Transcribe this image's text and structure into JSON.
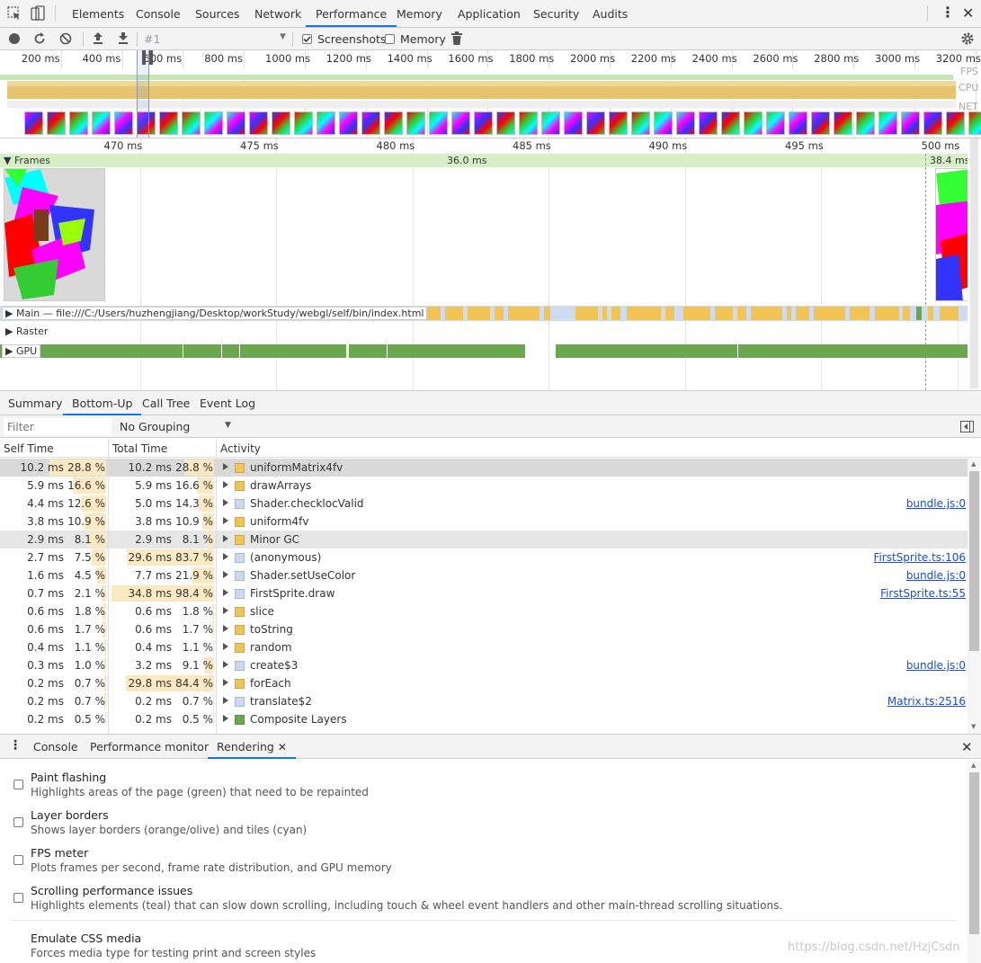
{
  "main_tabs": [
    "Elements",
    "Console",
    "Sources",
    "Network",
    "Performance",
    "Memory",
    "Application",
    "Security",
    "Audits"
  ],
  "toolbar": {
    "recording": "#1",
    "screenshots_label": "Screenshots",
    "memory_label": "Memory"
  },
  "overview": {
    "ticks": [
      "200 ms",
      "400 ms",
      "600 ms",
      "800 ms",
      "1000 ms",
      "1200 ms",
      "1400 ms",
      "1600 ms",
      "1800 ms",
      "2000 ms",
      "2200 ms",
      "2400 ms",
      "2600 ms",
      "2800 ms",
      "3000 ms",
      "3200 ms"
    ],
    "lanes": [
      "FPS",
      "CPU",
      "NET"
    ]
  },
  "ruler": {
    "ticks": [
      "470 ms",
      "475 ms",
      "480 ms",
      "485 ms",
      "490 ms",
      "495 ms",
      "500 ms"
    ]
  },
  "frames": {
    "label": "Frames",
    "duration": "36.0 ms",
    "next_duration": "38.4 ms"
  },
  "tracks": {
    "main": "Main — file:///C:/Users/huzhengjiang/Desktop/workStudy/webgl/self/bin/index.html",
    "raster": "Raster",
    "gpu": "GPU"
  },
  "bottom_tabs": [
    "Summary",
    "Bottom-Up",
    "Call Tree",
    "Event Log"
  ],
  "filter": {
    "placeholder": "Filter",
    "grouping": "No Grouping"
  },
  "columns": {
    "self": "Self Time",
    "total": "Total Time",
    "activity": "Activity"
  },
  "colors": {
    "scripting": "#f1c453",
    "system": "#c9d9f0",
    "rendering": "#6aa84f",
    "accent": "#1a73e8",
    "link": "#1a4ed8"
  },
  "rows": [
    {
      "self_ms": "10.2 ms",
      "self_pct": "28.8 %",
      "self_frac": 0.288,
      "total_ms": "10.2 ms",
      "total_pct": "28.8 %",
      "total_frac": 0.288,
      "activity": "uniformMatrix4fv",
      "cat": "scripting",
      "source": ""
    },
    {
      "self_ms": "5.9 ms",
      "self_pct": "16.6 %",
      "self_frac": 0.166,
      "total_ms": "5.9 ms",
      "total_pct": "16.6 %",
      "total_frac": 0.166,
      "activity": "drawArrays",
      "cat": "scripting",
      "source": ""
    },
    {
      "self_ms": "4.4 ms",
      "self_pct": "12.6 %",
      "self_frac": 0.126,
      "total_ms": "5.0 ms",
      "total_pct": "14.3 %",
      "total_frac": 0.143,
      "activity": "Shader.checklocValid",
      "cat": "system",
      "source": "bundle.js:0"
    },
    {
      "self_ms": "3.8 ms",
      "self_pct": "10.9 %",
      "self_frac": 0.109,
      "total_ms": "3.8 ms",
      "total_pct": "10.9 %",
      "total_frac": 0.109,
      "activity": "uniform4fv",
      "cat": "scripting",
      "source": ""
    },
    {
      "self_ms": "2.9 ms",
      "self_pct": "8.1 %",
      "self_frac": 0.081,
      "total_ms": "2.9 ms",
      "total_pct": "8.1 %",
      "total_frac": 0.081,
      "activity": "Minor GC",
      "cat": "scripting",
      "source": ""
    },
    {
      "self_ms": "2.7 ms",
      "self_pct": "7.5 %",
      "self_frac": 0.075,
      "total_ms": "29.6 ms",
      "total_pct": "83.7 %",
      "total_frac": 0.837,
      "activity": "(anonymous)",
      "cat": "system",
      "source": "FirstSprite.ts:106"
    },
    {
      "self_ms": "1.6 ms",
      "self_pct": "4.5 %",
      "self_frac": 0.045,
      "total_ms": "7.7 ms",
      "total_pct": "21.9 %",
      "total_frac": 0.219,
      "activity": "Shader.setUseColor",
      "cat": "system",
      "source": "bundle.js:0"
    },
    {
      "self_ms": "0.7 ms",
      "self_pct": "2.1 %",
      "self_frac": 0.021,
      "total_ms": "34.8 ms",
      "total_pct": "98.4 %",
      "total_frac": 0.984,
      "activity": "FirstSprite.draw",
      "cat": "system",
      "source": "FirstSprite.ts:55"
    },
    {
      "self_ms": "0.6 ms",
      "self_pct": "1.8 %",
      "self_frac": 0.018,
      "total_ms": "0.6 ms",
      "total_pct": "1.8 %",
      "total_frac": 0.018,
      "activity": "slice",
      "cat": "scripting",
      "source": ""
    },
    {
      "self_ms": "0.6 ms",
      "self_pct": "1.7 %",
      "self_frac": 0.017,
      "total_ms": "0.6 ms",
      "total_pct": "1.7 %",
      "total_frac": 0.017,
      "activity": "toString",
      "cat": "scripting",
      "source": ""
    },
    {
      "self_ms": "0.4 ms",
      "self_pct": "1.1 %",
      "self_frac": 0.011,
      "total_ms": "0.4 ms",
      "total_pct": "1.1 %",
      "total_frac": 0.011,
      "activity": "random",
      "cat": "scripting",
      "source": ""
    },
    {
      "self_ms": "0.3 ms",
      "self_pct": "1.0 %",
      "self_frac": 0.01,
      "total_ms": "3.2 ms",
      "total_pct": "9.1 %",
      "total_frac": 0.091,
      "activity": "create$3",
      "cat": "system",
      "source": "bundle.js:0"
    },
    {
      "self_ms": "0.2 ms",
      "self_pct": "0.7 %",
      "self_frac": 0.007,
      "total_ms": "29.8 ms",
      "total_pct": "84.4 %",
      "total_frac": 0.844,
      "activity": "forEach",
      "cat": "scripting",
      "source": ""
    },
    {
      "self_ms": "0.2 ms",
      "self_pct": "0.7 %",
      "self_frac": 0.007,
      "total_ms": "0.2 ms",
      "total_pct": "0.7 %",
      "total_frac": 0.007,
      "activity": "translate$2",
      "cat": "system",
      "source": "Matrix.ts:2516"
    },
    {
      "self_ms": "0.2 ms",
      "self_pct": "0.5 %",
      "self_frac": 0.005,
      "total_ms": "0.2 ms",
      "total_pct": "0.5 %",
      "total_frac": 0.005,
      "activity": "Composite Layers",
      "cat": "rendering",
      "source": ""
    }
  ],
  "drawer": {
    "tabs": [
      "Console",
      "Performance monitor",
      "Rendering"
    ],
    "options": [
      {
        "title": "Paint flashing",
        "desc": "Highlights areas of the page (green) that need to be repainted"
      },
      {
        "title": "Layer borders",
        "desc": "Shows layer borders (orange/olive) and tiles (cyan)"
      },
      {
        "title": "FPS meter",
        "desc": "Plots frames per second, frame rate distribution, and GPU memory"
      },
      {
        "title": "Scrolling performance issues",
        "desc": "Highlights elements (teal) that can slow down scrolling, including touch & wheel event handlers and other main-thread scrolling situations."
      },
      {
        "title": "Emulate CSS media",
        "desc": "Forces media type for testing print and screen styles"
      }
    ]
  },
  "watermark": "https://blog.csdn.net/HzjCsdn"
}
